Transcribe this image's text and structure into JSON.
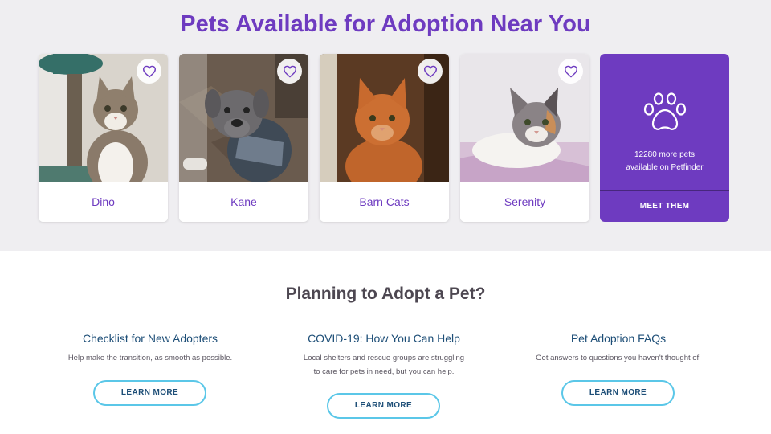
{
  "header": {
    "title": "Pets Available for Adoption Near You"
  },
  "pets": [
    {
      "name": "Dino",
      "photo": "tabby-white-cat",
      "icon": "heart-icon"
    },
    {
      "name": "Kane",
      "photo": "gray-pitbull-dog",
      "icon": "heart-icon"
    },
    {
      "name": "Barn Cats",
      "photo": "orange-cat",
      "icon": "heart-icon"
    },
    {
      "name": "Serenity",
      "photo": "calico-cat",
      "icon": "heart-icon"
    }
  ],
  "more_card": {
    "icon": "paw-icon",
    "count_text": "12280 more pets",
    "sub_text": "available on Petfinder",
    "button_label": "MEET THEM"
  },
  "planning": {
    "title": "Planning to Adopt a Pet?",
    "columns": [
      {
        "heading": "Checklist for New Adopters",
        "body": [
          "Help make the transition, as smooth as possible."
        ],
        "button": "LEARN MORE"
      },
      {
        "heading": "COVID-19: How You Can Help",
        "body": [
          "Local shelters and rescue groups are struggling",
          "to care for pets in need, but you can help."
        ],
        "button": "LEARN MORE"
      },
      {
        "heading": "Pet Adoption FAQs",
        "body": [
          "Get answers to questions you haven't thought of."
        ],
        "button": "LEARN MORE"
      }
    ]
  },
  "colors": {
    "brand": "#6e3bc0",
    "heading_blue": "#1d4e77",
    "button_border": "#5bc7e8",
    "top_bg": "#efeef1"
  }
}
